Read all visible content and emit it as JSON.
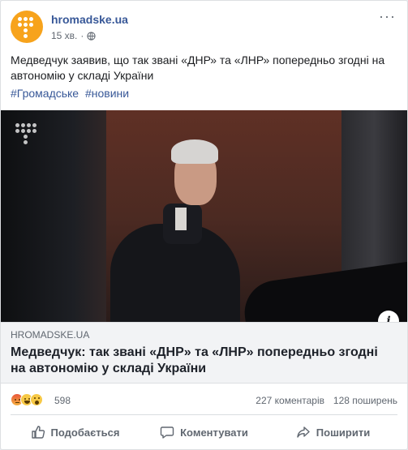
{
  "page": {
    "name": "hromadske.ua",
    "time": "15 хв.",
    "separator": "·",
    "privacy_icon": "globe-icon",
    "more_label": "···"
  },
  "post": {
    "text": "Медведчук заявив, що так звані «ДНР» та «ЛНР» попередньо згодні на автономію у складі України",
    "hashtags": [
      "#Громадське",
      "#новини"
    ]
  },
  "link": {
    "domain": "HROMADSKE.UA",
    "title": "Медведчук: так звані «ДНР» та «ЛНР» попередньо згодні на автономію у складі України",
    "info_label": "i"
  },
  "stats": {
    "reactions": [
      "angry",
      "haha",
      "wow"
    ],
    "reaction_count": "598",
    "comments": "227 коментарів",
    "shares": "128 поширень"
  },
  "actions": {
    "like": "Подобається",
    "comment": "Коментувати",
    "share": "Поширити"
  },
  "colors": {
    "link_blue": "#385898",
    "brand_orange": "#f7a31c",
    "muted_text": "#606770"
  }
}
